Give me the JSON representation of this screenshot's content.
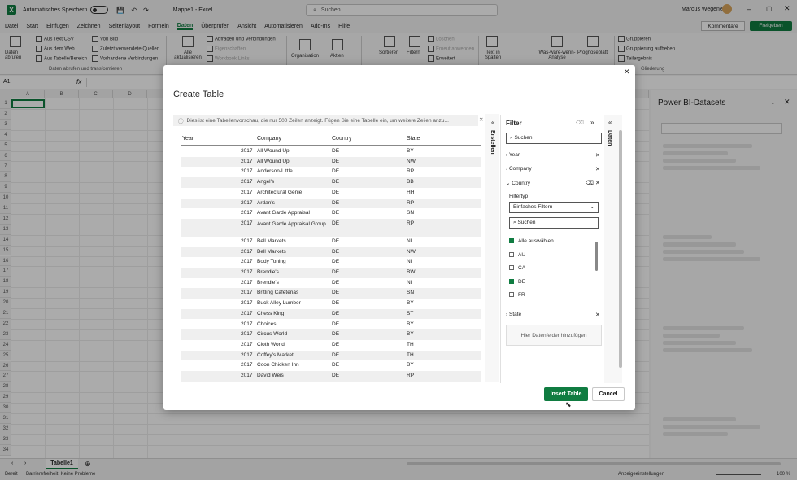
{
  "titlebar": {
    "autosave_label": "Automatisches Speichern",
    "doc_title": "Mappe1 - Excel",
    "search_placeholder": "Suchen",
    "user_name": "Marcus Wegener"
  },
  "menu": {
    "tabs": [
      "Datei",
      "Start",
      "Einfügen",
      "Zeichnen",
      "Seitenlayout",
      "Formeln",
      "Daten",
      "Überprüfen",
      "Ansicht",
      "Automatisieren",
      "Add-Ins",
      "Hilfe"
    ],
    "active_tab": "Daten",
    "comments": "Kommentare",
    "share": "Freigeben"
  },
  "ribbon": {
    "get_data": "Daten abrufen",
    "from_text": "Aus Text/CSV",
    "from_web": "Aus dem Web",
    "from_table": "Aus Tabelle/Bereich",
    "from_picture": "Von Bild",
    "recent_sources": "Zuletzt verwendete Quellen",
    "existing_connections": "Vorhandene Verbindungen",
    "group_get_transform": "Daten abrufen und transformieren",
    "refresh_all": "Alle aktualisieren",
    "queries_connections": "Abfragen und Verbindungen",
    "properties": "Eigenschaften",
    "workbook_links": "Workbook Links",
    "organisation": "Organisation",
    "stocks": "Aktien",
    "sort": "Sortieren",
    "filter": "Filtern",
    "clear": "Löschen",
    "reapply": "Erneut anwenden",
    "advanced": "Erweitert",
    "text_to_columns": "Text in Spalten",
    "what_if": "Was-wäre-wenn-Analyse",
    "forecast": "Prognoseblatt",
    "group": "Gruppieren",
    "ungroup": "Gruppierung aufheben",
    "subtotal": "Teilergebnis",
    "outline": "Gliederung"
  },
  "formula_bar": {
    "name_box": "A1",
    "fx": "fx"
  },
  "grid": {
    "columns": [
      "A",
      "B",
      "C",
      "D"
    ],
    "rows": [
      "1",
      "2",
      "3",
      "4",
      "5",
      "6",
      "7",
      "8",
      "9",
      "10",
      "11",
      "12",
      "13",
      "14",
      "15",
      "16",
      "17",
      "18",
      "19",
      "20",
      "21",
      "22",
      "23",
      "24",
      "25",
      "26",
      "27",
      "28",
      "29",
      "30",
      "31",
      "32",
      "33",
      "34"
    ]
  },
  "power_bi": {
    "title": "Power BI-Datasets"
  },
  "dialog": {
    "title": "Create Table",
    "info": "Dies ist eine Tabellenvorschau, die nur 500 Zeilen anzeigt. Fügen Sie eine Tabelle ein, um weitere Zeilen anzu...",
    "headers": [
      "Year",
      "Company",
      "Country",
      "State"
    ],
    "rows": [
      [
        "2017",
        "All Wound Up",
        "DE",
        "BY"
      ],
      [
        "2017",
        "All Wound Up",
        "DE",
        "NW"
      ],
      [
        "2017",
        "Anderson-Little",
        "DE",
        "RP"
      ],
      [
        "2017",
        "Angel's",
        "DE",
        "BB"
      ],
      [
        "2017",
        "Architectural Genie",
        "DE",
        "HH"
      ],
      [
        "2017",
        "Ardan's",
        "DE",
        "RP"
      ],
      [
        "2017",
        "Avant Garde Appraisal",
        "DE",
        "SN"
      ],
      [
        "2017",
        "Avant Garde Appraisal Group",
        "DE",
        "RP"
      ],
      [
        "2017",
        "Bell Markets",
        "DE",
        "NI"
      ],
      [
        "2017",
        "Bell Markets",
        "DE",
        "NW"
      ],
      [
        "2017",
        "Body Toning",
        "DE",
        "NI"
      ],
      [
        "2017",
        "Brendle's",
        "DE",
        "BW"
      ],
      [
        "2017",
        "Brendle's",
        "DE",
        "NI"
      ],
      [
        "2017",
        "Britling Cafeterias",
        "DE",
        "SN"
      ],
      [
        "2017",
        "Buck Alley Lumber",
        "DE",
        "BY"
      ],
      [
        "2017",
        "Chess King",
        "DE",
        "ST"
      ],
      [
        "2017",
        "Choices",
        "DE",
        "BY"
      ],
      [
        "2017",
        "Circus World",
        "DE",
        "BY"
      ],
      [
        "2017",
        "Cloth World",
        "DE",
        "TH"
      ],
      [
        "2017",
        "Coffey's Market",
        "DE",
        "TH"
      ],
      [
        "2017",
        "Coon Chicken Inn",
        "DE",
        "BY"
      ],
      [
        "2017",
        "David Weis",
        "DE",
        "RP"
      ]
    ],
    "side_tab_create": "Erstellen",
    "side_tab_data": "Daten",
    "insert_btn": "Insert Table",
    "cancel_btn": "Cancel"
  },
  "filter": {
    "title": "Filter",
    "search_placeholder": "Suchen",
    "fields": [
      "Year",
      "Company",
      "Country"
    ],
    "filter_type_label": "Filtertyp",
    "filter_type_value": "Einfaches Filtern",
    "inner_search": "Suchen",
    "options": [
      {
        "label": "Alle auswählen",
        "checked": true
      },
      {
        "label": "AU",
        "checked": false
      },
      {
        "label": "CA",
        "checked": false
      },
      {
        "label": "DE",
        "checked": true
      },
      {
        "label": "FR",
        "checked": false
      }
    ],
    "state_field": "State",
    "add_fields": "Hier Datenfelder hinzufügen"
  },
  "sheets": {
    "tab": "Tabelle1"
  },
  "status": {
    "ready": "Bereit",
    "accessibility": "Barrierefreiheit: Keine Probleme",
    "display_settings": "Anzeigeeinstellungen",
    "zoom": "100 %"
  }
}
